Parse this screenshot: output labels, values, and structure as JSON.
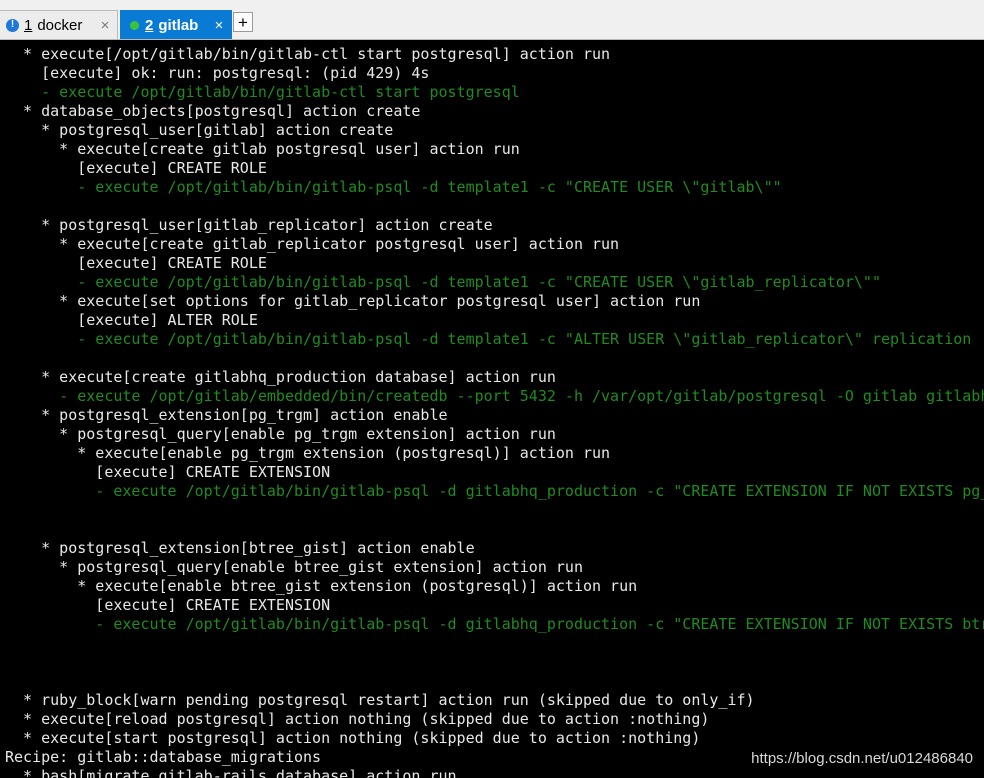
{
  "tabs": [
    {
      "number": "1",
      "label": "docker",
      "icon": "info-icon",
      "close": "×"
    },
    {
      "number": "2",
      "label": "gitlab",
      "icon": "connected-dot-icon",
      "close": "×",
      "active": true
    }
  ],
  "new_tab_label": "+",
  "colors": {
    "output": "#e8e8e8",
    "command": "#1e8c1e",
    "active_tab": "#0a7bd5",
    "background": "#000000"
  },
  "terminal_lines": [
    {
      "text": "  * execute[/opt/gitlab/bin/gitlab-ctl start postgresql] action run",
      "style": "normal"
    },
    {
      "text": "    [execute] ok: run: postgresql: (pid 429) 4s",
      "style": "normal"
    },
    {
      "text": "    - execute /opt/gitlab/bin/gitlab-ctl start postgresql",
      "style": "green"
    },
    {
      "text": "  * database_objects[postgresql] action create",
      "style": "normal"
    },
    {
      "text": "    * postgresql_user[gitlab] action create",
      "style": "normal"
    },
    {
      "text": "      * execute[create gitlab postgresql user] action run",
      "style": "normal"
    },
    {
      "text": "        [execute] CREATE ROLE",
      "style": "normal"
    },
    {
      "text": "        - execute /opt/gitlab/bin/gitlab-psql -d template1 -c \"CREATE USER \\\"gitlab\\\"\"",
      "style": "green"
    },
    {
      "text": "",
      "style": "normal"
    },
    {
      "text": "    * postgresql_user[gitlab_replicator] action create",
      "style": "normal"
    },
    {
      "text": "      * execute[create gitlab_replicator postgresql user] action run",
      "style": "normal"
    },
    {
      "text": "        [execute] CREATE ROLE",
      "style": "normal"
    },
    {
      "text": "        - execute /opt/gitlab/bin/gitlab-psql -d template1 -c \"CREATE USER \\\"gitlab_replicator\\\"\"",
      "style": "green"
    },
    {
      "text": "      * execute[set options for gitlab_replicator postgresql user] action run",
      "style": "normal"
    },
    {
      "text": "        [execute] ALTER ROLE",
      "style": "normal"
    },
    {
      "text": "        - execute /opt/gitlab/bin/gitlab-psql -d template1 -c \"ALTER USER \\\"gitlab_replicator\\\" replication",
      "style": "green"
    },
    {
      "text": "",
      "style": "normal"
    },
    {
      "text": "    * execute[create gitlabhq_production database] action run",
      "style": "normal"
    },
    {
      "text": "      - execute /opt/gitlab/embedded/bin/createdb --port 5432 -h /var/opt/gitlab/postgresql -O gitlab gitlabh",
      "style": "green"
    },
    {
      "text": "    * postgresql_extension[pg_trgm] action enable",
      "style": "normal"
    },
    {
      "text": "      * postgresql_query[enable pg_trgm extension] action run",
      "style": "normal"
    },
    {
      "text": "        * execute[enable pg_trgm extension (postgresql)] action run",
      "style": "normal"
    },
    {
      "text": "          [execute] CREATE EXTENSION",
      "style": "normal"
    },
    {
      "text": "          - execute /opt/gitlab/bin/gitlab-psql -d gitlabhq_production -c \"CREATE EXTENSION IF NOT EXISTS pg_",
      "style": "green"
    },
    {
      "text": "",
      "style": "normal"
    },
    {
      "text": "",
      "style": "normal"
    },
    {
      "text": "    * postgresql_extension[btree_gist] action enable",
      "style": "normal"
    },
    {
      "text": "      * postgresql_query[enable btree_gist extension] action run",
      "style": "normal"
    },
    {
      "text": "        * execute[enable btree_gist extension (postgresql)] action run",
      "style": "normal"
    },
    {
      "text": "          [execute] CREATE EXTENSION",
      "style": "normal"
    },
    {
      "text": "          - execute /opt/gitlab/bin/gitlab-psql -d gitlabhq_production -c \"CREATE EXTENSION IF NOT EXISTS btr",
      "style": "green"
    },
    {
      "text": "",
      "style": "normal"
    },
    {
      "text": "",
      "style": "normal"
    },
    {
      "text": "",
      "style": "normal"
    },
    {
      "text": "  * ruby_block[warn pending postgresql restart] action run (skipped due to only_if)",
      "style": "normal"
    },
    {
      "text": "  * execute[reload postgresql] action nothing (skipped due to action :nothing)",
      "style": "normal"
    },
    {
      "text": "  * execute[start postgresql] action nothing (skipped due to action :nothing)",
      "style": "normal"
    },
    {
      "text": "Recipe: gitlab::database_migrations",
      "style": "normal"
    },
    {
      "text": "  * bash[migrate gitlab-rails database] action run",
      "style": "normal"
    }
  ],
  "watermark": "https://blog.csdn.net/u012486840"
}
